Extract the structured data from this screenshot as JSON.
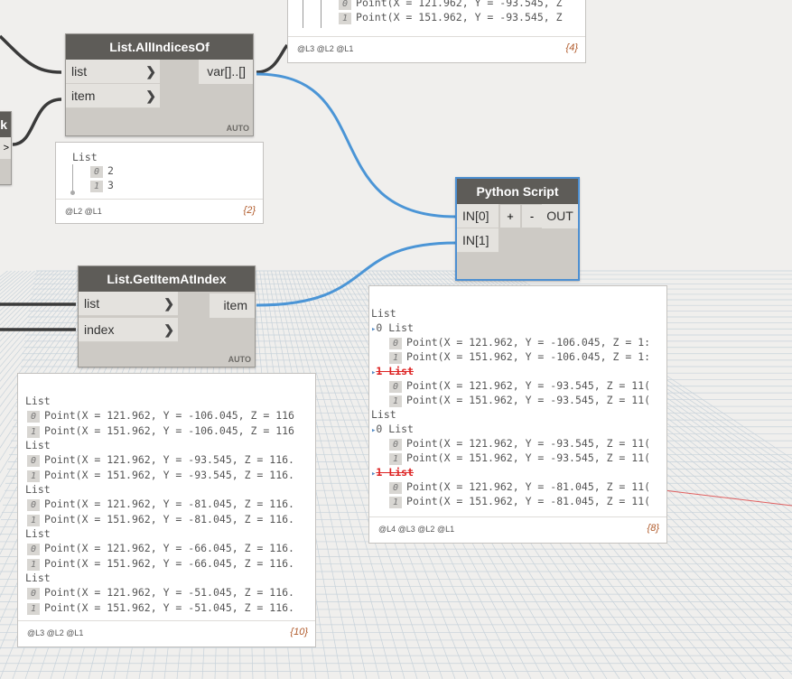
{
  "nodes": {
    "all_indices": {
      "title": "List.AllIndicesOf",
      "in1": "list",
      "in2": "item",
      "out": "var[]..[]",
      "auto": "AUTO"
    },
    "get_item": {
      "title": "List.GetItemAtIndex",
      "in1": "list",
      "in2": "index",
      "out": "item",
      "auto": "AUTO"
    },
    "python": {
      "title": "Python Script",
      "in0": "IN[0]",
      "in1": "IN[1]",
      "plus": "+",
      "minus": "-",
      "out": "OUT"
    },
    "partial_left": {
      "title": "k",
      "port": ">"
    }
  },
  "previews": {
    "top": {
      "lines": [
        {
          "idx": "0",
          "text": "Point(X = 121.962, Y = -93.545, Z"
        },
        {
          "idx": "1",
          "text": "Point(X = 151.962, Y = -93.545, Z"
        }
      ],
      "levels": "@L3 @L2 @L1",
      "count": "{4}"
    },
    "indices": {
      "head": "List",
      "lines": [
        {
          "idx": "0",
          "text": "2"
        },
        {
          "idx": "1",
          "text": "3"
        }
      ],
      "levels": "@L2 @L1",
      "count": "{2}"
    },
    "getitem": {
      "groups": [
        {
          "head": "List",
          "p0": "Point(X = 121.962, Y = -106.045, Z = 116",
          "p1": "Point(X = 151.962, Y = -106.045, Z = 116"
        },
        {
          "head": "List",
          "p0": "Point(X = 121.962, Y = -93.545, Z = 116.",
          "p1": "Point(X = 151.962, Y = -93.545, Z = 116."
        },
        {
          "head": "List",
          "p0": "Point(X = 121.962, Y = -81.045, Z = 116.",
          "p1": "Point(X = 151.962, Y = -81.045, Z = 116."
        },
        {
          "head": "List",
          "p0": "Point(X = 121.962, Y = -66.045, Z = 116.",
          "p1": "Point(X = 151.962, Y = -66.045, Z = 116."
        },
        {
          "head": "List",
          "p0": "Point(X = 121.962, Y = -51.045, Z = 116.",
          "p1": "Point(X = 151.962, Y = -51.045, Z = 116."
        }
      ],
      "levels": "@L3 @L2 @L1",
      "count": "{10}"
    },
    "python": {
      "rows": [
        {
          "kind": "head",
          "text": "List"
        },
        {
          "kind": "sub",
          "text": "0 List"
        },
        {
          "kind": "pt",
          "idx": "0",
          "text": "Point(X = 121.962, Y = -106.045, Z = 1:"
        },
        {
          "kind": "pt",
          "idx": "1",
          "text": "Point(X = 151.962, Y = -106.045, Z = 1:"
        },
        {
          "kind": "strike",
          "text": "1 List"
        },
        {
          "kind": "pt",
          "idx": "0",
          "text": "Point(X = 121.962, Y = -93.545, Z = 11("
        },
        {
          "kind": "pt",
          "idx": "1",
          "text": "Point(X = 151.962, Y = -93.545, Z = 11("
        },
        {
          "kind": "head",
          "text": "List"
        },
        {
          "kind": "sub",
          "text": "0 List"
        },
        {
          "kind": "pt",
          "idx": "0",
          "text": "Point(X = 121.962, Y = -93.545, Z = 11("
        },
        {
          "kind": "pt",
          "idx": "1",
          "text": "Point(X = 151.962, Y = -93.545, Z = 11("
        },
        {
          "kind": "strike",
          "text": "1 List"
        },
        {
          "kind": "pt",
          "idx": "0",
          "text": "Point(X = 121.962, Y = -81.045, Z = 11("
        },
        {
          "kind": "pt",
          "idx": "1",
          "text": "Point(X = 151.962, Y = -81.045, Z = 11("
        }
      ],
      "levels": "@L4 @L3 @L2 @L1",
      "count": "{8}"
    }
  },
  "colors": {
    "wire_selected": "#4b95d6",
    "wire_default": "#3a3a3a",
    "node_header": "#5e5c58",
    "grid": "#c9d4dc"
  }
}
